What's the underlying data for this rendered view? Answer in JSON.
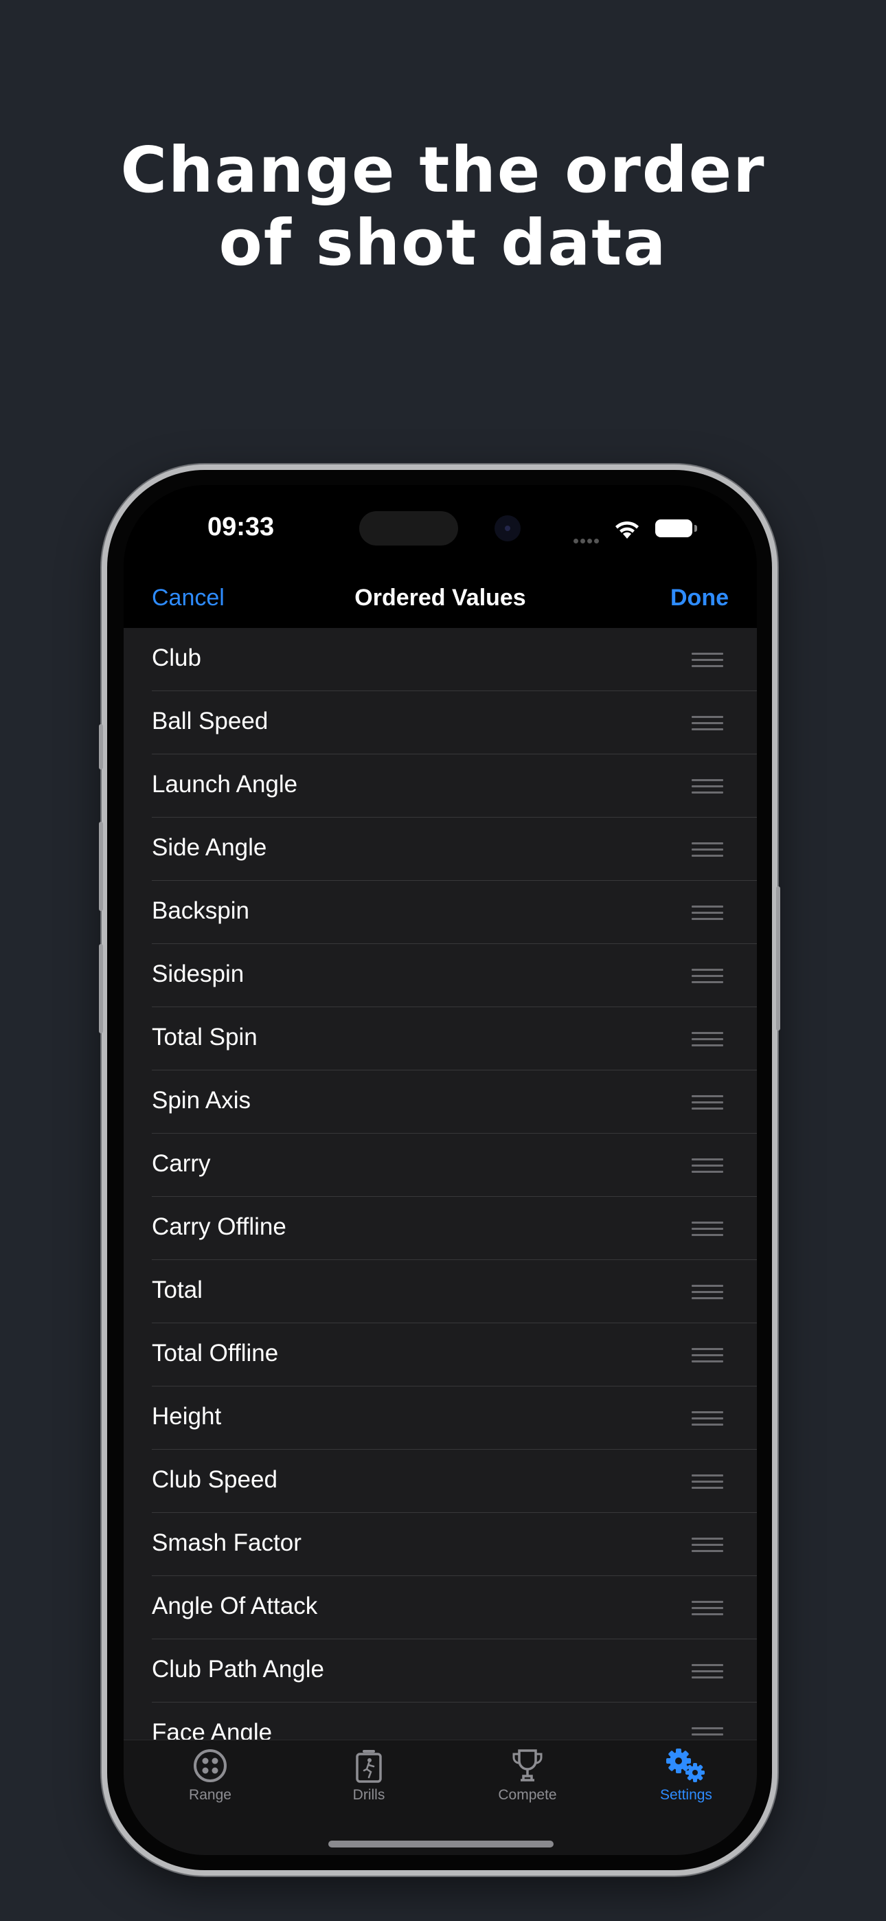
{
  "headline": {
    "line1": "Change the order",
    "line2": "of shot data"
  },
  "status_bar": {
    "time": "09:33"
  },
  "nav": {
    "cancel_label": "Cancel",
    "title": "Ordered Values",
    "done_label": "Done"
  },
  "list": {
    "items": [
      "Club",
      "Ball Speed",
      "Launch Angle",
      "Side Angle",
      "Backspin",
      "Sidespin",
      "Total Spin",
      "Spin Axis",
      "Carry",
      "Carry Offline",
      "Total",
      "Total Offline",
      "Height",
      "Club Speed",
      "Smash Factor",
      "Angle Of Attack",
      "Club Path Angle",
      "Face Angle"
    ]
  },
  "tabbar": {
    "tabs": [
      {
        "label": "Range",
        "icon": "golf-ball-icon",
        "active": false
      },
      {
        "label": "Drills",
        "icon": "drills-clipboard-icon",
        "active": false
      },
      {
        "label": "Compete",
        "icon": "trophy-icon",
        "active": false
      },
      {
        "label": "Settings",
        "icon": "gears-icon",
        "active": true
      }
    ]
  },
  "colors": {
    "background": "#22262d",
    "accent": "#2e8cff",
    "list_background": "#1c1c1e"
  }
}
